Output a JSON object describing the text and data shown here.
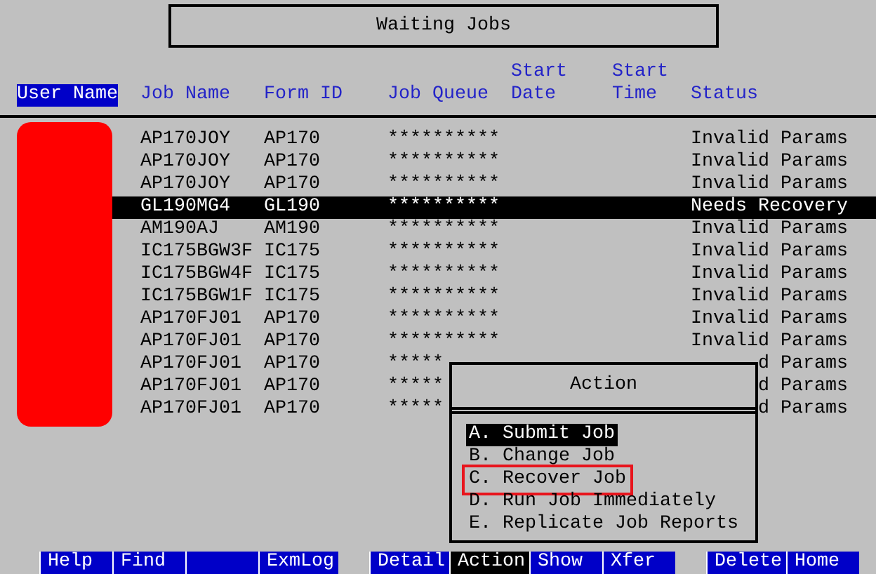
{
  "title": "Waiting Jobs",
  "columns": [
    {
      "label": "User Name",
      "selected": true
    },
    {
      "label": "Job Name",
      "selected": false
    },
    {
      "label": "Form ID",
      "selected": false
    },
    {
      "label": "Job Queue",
      "selected": false
    },
    {
      "label": "Start Date",
      "selected": false
    },
    {
      "label": "Start Time",
      "selected": false
    },
    {
      "label": "Status",
      "selected": false
    }
  ],
  "rows": [
    {
      "job_name": "AP170JOY",
      "form_id": "AP170",
      "job_queue": "**********",
      "status": "Invalid Params",
      "selected": false
    },
    {
      "job_name": "AP170JOY",
      "form_id": "AP170",
      "job_queue": "**********",
      "status": "Invalid Params",
      "selected": false
    },
    {
      "job_name": "AP170JOY",
      "form_id": "AP170",
      "job_queue": "**********",
      "status": "Invalid Params",
      "selected": false
    },
    {
      "job_name": "GL190MG4",
      "form_id": "GL190",
      "job_queue": "**********",
      "status": "Needs Recovery",
      "selected": true
    },
    {
      "job_name": "AM190AJ",
      "form_id": "AM190",
      "job_queue": "**********",
      "status": "Invalid Params",
      "selected": false
    },
    {
      "job_name": "IC175BGW3F",
      "form_id": "IC175",
      "job_queue": "**********",
      "status": "Invalid Params",
      "selected": false
    },
    {
      "job_name": "IC175BGW4F",
      "form_id": "IC175",
      "job_queue": "**********",
      "status": "Invalid Params",
      "selected": false
    },
    {
      "job_name": "IC175BGW1F",
      "form_id": "IC175",
      "job_queue": "**********",
      "status": "Invalid Params",
      "selected": false
    },
    {
      "job_name": "AP170FJ01",
      "form_id": "AP170",
      "job_queue": "**********",
      "status": "Invalid Params",
      "selected": false
    },
    {
      "job_name": "AP170FJ01",
      "form_id": "AP170",
      "job_queue": "**********",
      "status": "Invalid Params",
      "selected": false
    },
    {
      "job_name": "AP170FJ01",
      "form_id": "AP170",
      "job_queue": "*****",
      "status": "d Params",
      "selected": false
    },
    {
      "job_name": "AP170FJ01",
      "form_id": "AP170",
      "job_queue": "*****",
      "status": "d Params",
      "selected": false
    },
    {
      "job_name": "AP170FJ01",
      "form_id": "AP170",
      "job_queue": "*****",
      "status": "d Params",
      "selected": false
    }
  ],
  "action_menu": {
    "title": "Action",
    "items": [
      {
        "label": "A. Submit Job",
        "selected": true,
        "highlighted": false
      },
      {
        "label": "B. Change Job",
        "selected": false,
        "highlighted": false
      },
      {
        "label": "C. Recover Job",
        "selected": false,
        "highlighted": true
      },
      {
        "label": "D. Run Job Immediately",
        "selected": false,
        "highlighted": false
      },
      {
        "label": "E. Replicate Job Reports",
        "selected": false,
        "highlighted": false
      }
    ]
  },
  "function_keys": [
    {
      "kind": "key",
      "label": "Help",
      "selected": false
    },
    {
      "kind": "key",
      "label": "Find",
      "selected": false
    },
    {
      "kind": "blank"
    },
    {
      "kind": "key",
      "label": "ExmLog",
      "selected": false
    },
    {
      "kind": "gap"
    },
    {
      "kind": "key",
      "label": "Detail",
      "selected": false
    },
    {
      "kind": "key",
      "label": "Action",
      "selected": true
    },
    {
      "kind": "key",
      "label": "Show",
      "selected": false
    },
    {
      "kind": "key",
      "label": "Xfer",
      "selected": false
    },
    {
      "kind": "gap"
    },
    {
      "kind": "key",
      "label": "Delete",
      "selected": false
    },
    {
      "kind": "key",
      "label": "Home",
      "selected": false
    }
  ]
}
